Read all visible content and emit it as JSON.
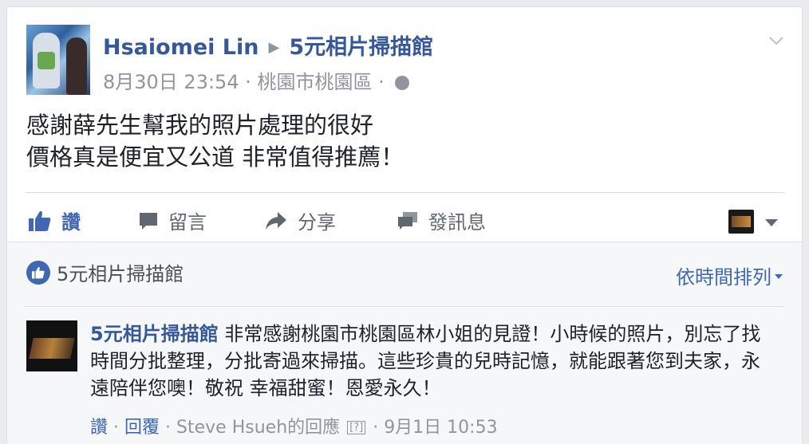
{
  "post": {
    "author": "Hsaiomei Lin",
    "target_page": "5元相片掃描館",
    "date": "8月30日 23:54",
    "location": "桃園市桃園區",
    "separator": "·",
    "text_line1": "感謝薛先生幫我的照片處理的很好",
    "text_line2": "價格真是便宜又公道 非常值得推薦！"
  },
  "actions": {
    "like": "讚",
    "comment": "留言",
    "share": "分享",
    "send": "發訊息"
  },
  "likes": {
    "liker": "5元相片掃描館"
  },
  "sort": {
    "label": "依時間排列"
  },
  "comment": {
    "author": "5元相片掃描館",
    "text": "非常感謝桃園市桃園區林小姐的見證！小時候的照片，別忘了找時間分批整理，分批寄過來掃描。這些珍貴的兒時記憶，就能跟著您到夫家，永遠陪伴您噢！敬祝 幸福甜蜜！恩愛永久！",
    "like": "讚",
    "reply": "回覆",
    "replied_by": "Steve Hsueh的回應",
    "help": "[?]",
    "date": "9月1日 10:53"
  },
  "colors": {
    "link_blue": "#365899",
    "accent_blue": "#4267b2",
    "meta_grey": "#90949c"
  }
}
